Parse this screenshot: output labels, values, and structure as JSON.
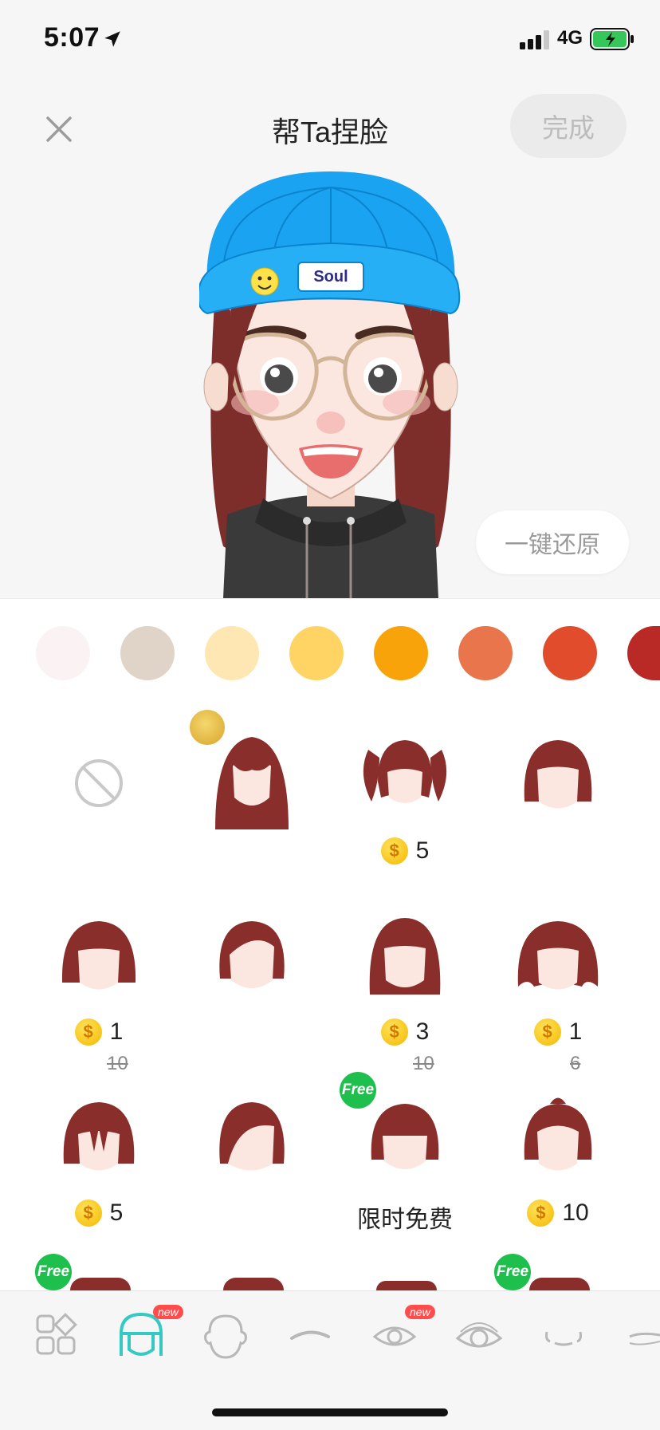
{
  "status_bar": {
    "time": "5:07",
    "network": "4G"
  },
  "header": {
    "title": "帮Ta捏脸",
    "done_label": "完成"
  },
  "avatar": {
    "hat_text": "Soul"
  },
  "reset_label": "一键还原",
  "colors": [
    "#fbf2f3",
    "#e0d4c8",
    "#ffe7b3",
    "#ffd465",
    "#f9a30b",
    "#e8754c",
    "#e04c2c",
    "#b92a26"
  ],
  "items": [
    {
      "name": "none"
    },
    {
      "name": "crown-hair",
      "premium": true
    },
    {
      "name": "pigtails",
      "price": "5"
    },
    {
      "name": "short-bob"
    },
    {
      "name": "bob-bangs",
      "price": "1",
      "original": "10"
    },
    {
      "name": "side-part"
    },
    {
      "name": "long-bob",
      "price": "3",
      "original": "10"
    },
    {
      "name": "curly-bob",
      "price": "1",
      "original": "6"
    },
    {
      "name": "messy-bob",
      "price": "5"
    },
    {
      "name": "side-swept"
    },
    {
      "name": "blunt-bob",
      "free": true,
      "label": "限时免费"
    },
    {
      "name": "top-knot",
      "price": "10"
    }
  ],
  "free_badge": "Free",
  "new_badge": "new",
  "tabs": [
    "layout",
    "hair",
    "face",
    "eyebrow",
    "eye",
    "eye-style",
    "mouth",
    "mustache"
  ]
}
